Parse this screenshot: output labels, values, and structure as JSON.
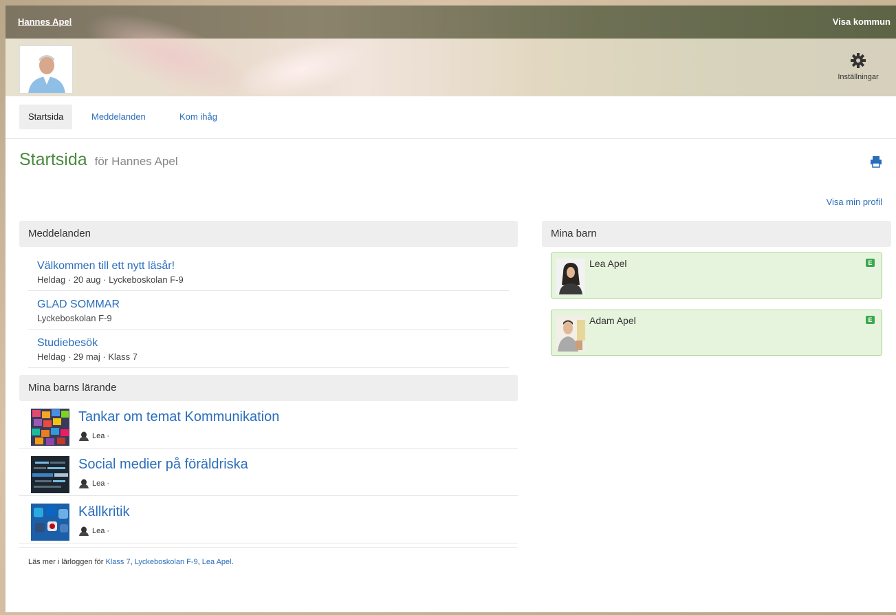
{
  "header": {
    "user_name": "Hannes Apel",
    "kommun_link": "Visa kommun",
    "settings_label": "Inställningar"
  },
  "tabs": [
    {
      "label": "Startsida",
      "active": true
    },
    {
      "label": "Meddelanden",
      "active": false
    },
    {
      "label": "Kom ihåg",
      "active": false
    }
  ],
  "page": {
    "title": "Startsida",
    "subtitle": "för Hannes Apel",
    "profile_link": "Visa min profil"
  },
  "messages": {
    "heading": "Meddelanden",
    "items": [
      {
        "title": "Välkommen till ett nytt läsår!",
        "meta": "Heldag · 20 aug · Lyckeboskolan F-9"
      },
      {
        "title": "GLAD SOMMAR",
        "meta": "Lyckeboskolan F-9"
      },
      {
        "title": "Studiebesök",
        "meta": "Heldag · 29 maj · Klass 7"
      }
    ]
  },
  "learning": {
    "heading": "Mina barns lärande",
    "items": [
      {
        "title": "Tankar om temat Kommunikation",
        "child": "Lea ·"
      },
      {
        "title": "Social medier på föräldriska",
        "child": "Lea ·"
      },
      {
        "title": "Källkritik",
        "child": "Lea ·"
      }
    ],
    "footer_prefix": "Läs mer i lärloggen för",
    "footer_links": [
      "Klass 7",
      "Lyckeboskolan F-9",
      "Lea Apel"
    ],
    "footer_sep": ", ",
    "footer_end": "."
  },
  "children": {
    "heading": "Mina barn",
    "items": [
      {
        "name": "Lea Apel",
        "badge": "E"
      },
      {
        "name": "Adam Apel",
        "badge": "E"
      }
    ]
  },
  "colors": {
    "link": "#2a6ebb",
    "title_green": "#4a8a3e",
    "child_card_bg": "#e7f4dd",
    "badge_green": "#3aa94d"
  }
}
